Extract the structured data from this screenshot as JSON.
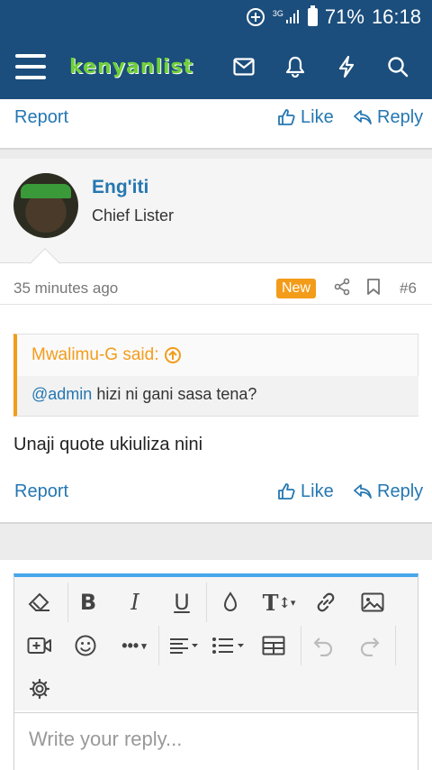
{
  "statusbar": {
    "network": "3G",
    "battery": "71%",
    "time": "16:18"
  },
  "header": {
    "logo": "kenyanlist"
  },
  "post_prev": {
    "report": "Report",
    "like": "Like",
    "reply": "Reply"
  },
  "post": {
    "username": "Eng'iti",
    "usertitle": "Chief Lister",
    "time": "35 minutes ago",
    "badge": "New",
    "number": "#6",
    "quote": {
      "author": "Mwalimu-G said:",
      "mention": "@admin",
      "text": " hizi ni gani sasa tena?"
    },
    "message": "Unaji quote ukiuliza nini",
    "report": "Report",
    "like": "Like",
    "reply": "Reply"
  },
  "editor": {
    "placeholder": "Write your reply..."
  },
  "colors": {
    "header": "#1b4e7c",
    "link": "#2577b1",
    "accent": "#f39c1a",
    "editor_border": "#47a7eb"
  }
}
